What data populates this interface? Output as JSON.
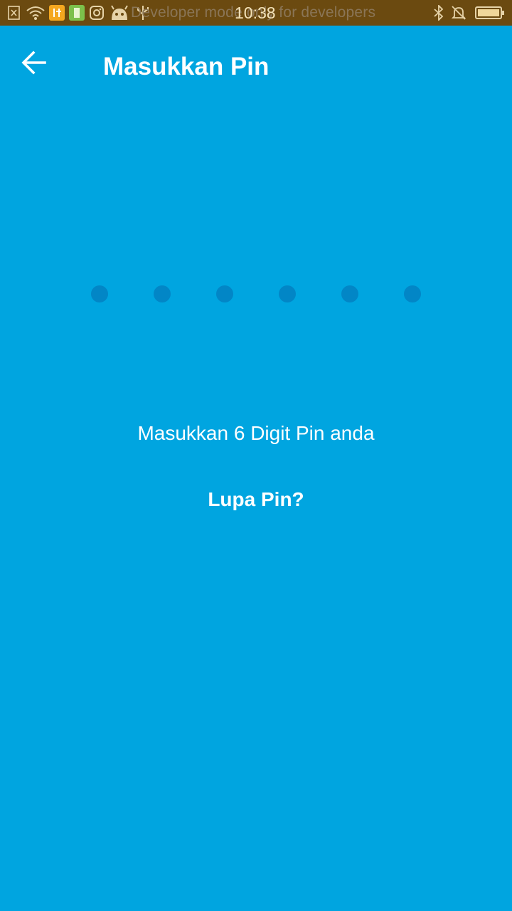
{
  "status_bar": {
    "time": "10:38",
    "notification_text": "Developer mode only for developers",
    "icons": [
      "sim-off-icon",
      "wifi-icon",
      "tools-app-icon",
      "battery-saver-app-icon",
      "instagram-icon",
      "android-debug-icon",
      "usb-icon",
      "bluetooth-icon",
      "silent-bell-icon",
      "battery-icon"
    ]
  },
  "header": {
    "title": "Masukkan Pin",
    "back_icon": "arrow-left-icon"
  },
  "pin": {
    "length": 6,
    "filled": 0
  },
  "main": {
    "instruction": "Masukkan 6 Digit Pin anda",
    "forgot_pin_label": "Lupa Pin?"
  },
  "colors": {
    "background": "#00A5E0",
    "status_bar": "#6B4A10",
    "dot_empty": "#0286C6",
    "text": "#FFFFFF"
  }
}
